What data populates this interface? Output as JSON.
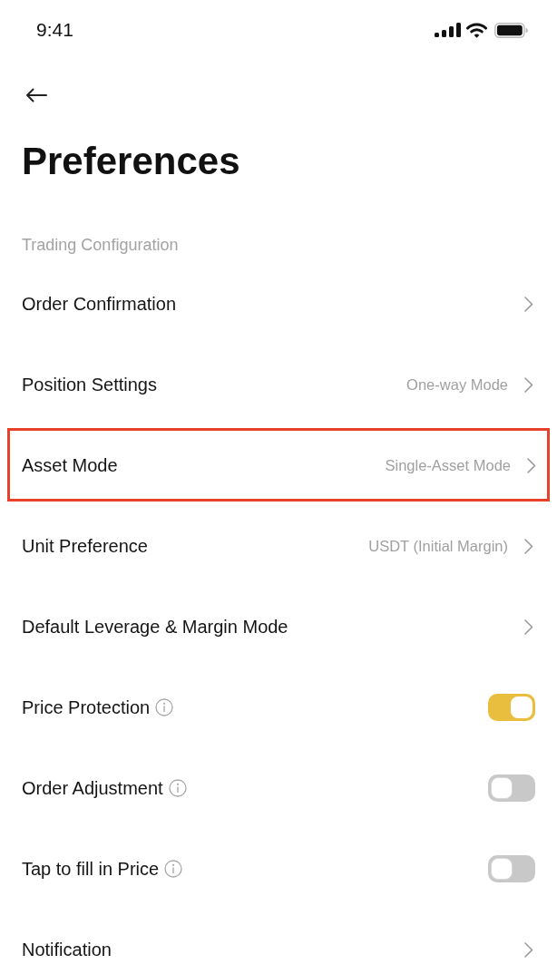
{
  "status_bar": {
    "time": "9:41"
  },
  "header": {
    "title": "Preferences"
  },
  "section": {
    "title": "Trading Configuration",
    "items": [
      {
        "kind": "link",
        "label": "Order Confirmation",
        "highlighted": false
      },
      {
        "kind": "link",
        "label": "Position Settings",
        "value": "One-way Mode",
        "highlighted": false
      },
      {
        "kind": "link",
        "label": "Asset Mode",
        "value": "Single-Asset Mode",
        "highlighted": true
      },
      {
        "kind": "link",
        "label": "Unit Preference",
        "value": "USDT (Initial Margin)",
        "highlighted": false
      },
      {
        "kind": "link",
        "label": "Default Leverage & Margin Mode",
        "highlighted": false
      },
      {
        "kind": "toggle",
        "label": "Price Protection",
        "info": true,
        "on": true,
        "highlighted": false
      },
      {
        "kind": "toggle",
        "label": "Order Adjustment",
        "info": true,
        "on": false,
        "highlighted": false
      },
      {
        "kind": "toggle",
        "label": "Tap to fill in Price",
        "info": true,
        "on": false,
        "highlighted": false
      },
      {
        "kind": "link",
        "label": "Notification",
        "highlighted": false
      }
    ]
  }
}
